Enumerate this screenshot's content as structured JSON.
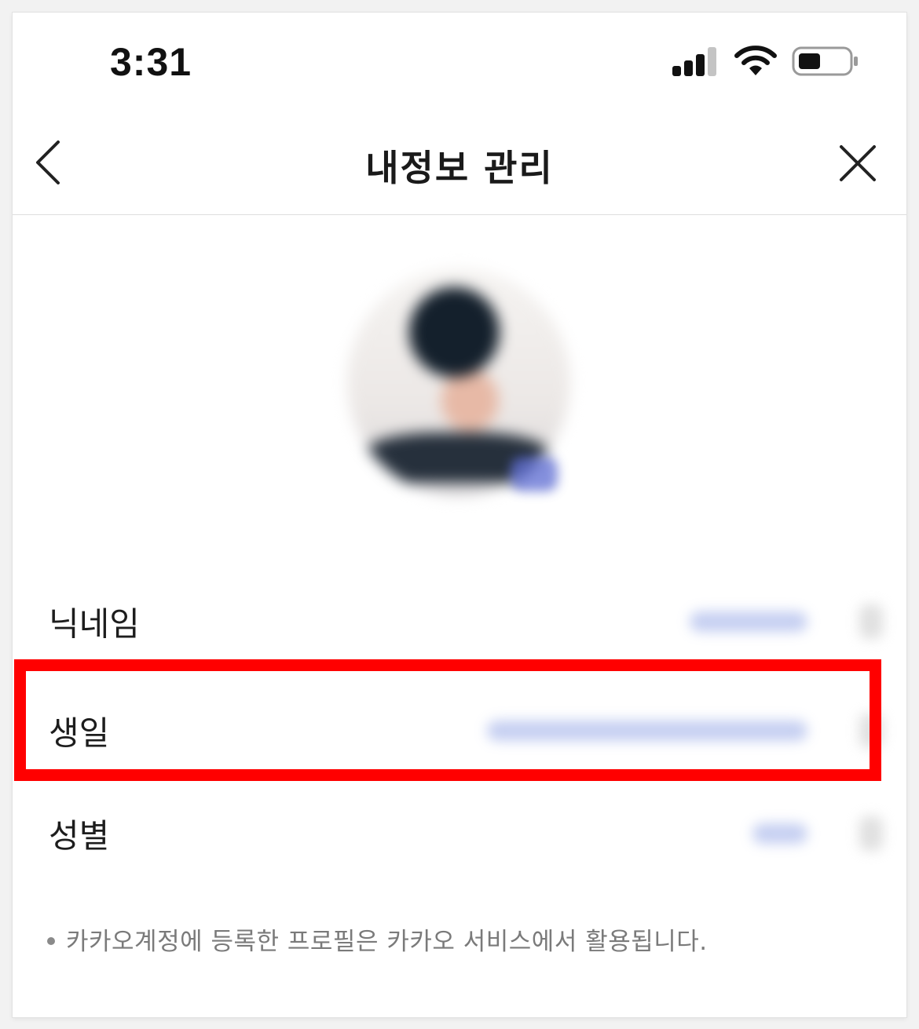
{
  "status_bar": {
    "time": "3:31",
    "icons": [
      "signal-icon",
      "wifi-icon",
      "battery-icon"
    ]
  },
  "nav": {
    "title": "내정보 관리",
    "back_icon": "chevron-left-icon",
    "close_icon": "close-icon"
  },
  "profile": {
    "avatar": "profile-photo-blurred"
  },
  "fields": [
    {
      "label": "닉네임"
    },
    {
      "label": "생일"
    },
    {
      "label": "성별"
    }
  ],
  "highlight_color": "#ff0000",
  "footnote": "카카오계정에 등록한 프로필은 카카오 서비스에서 활용됩니다."
}
